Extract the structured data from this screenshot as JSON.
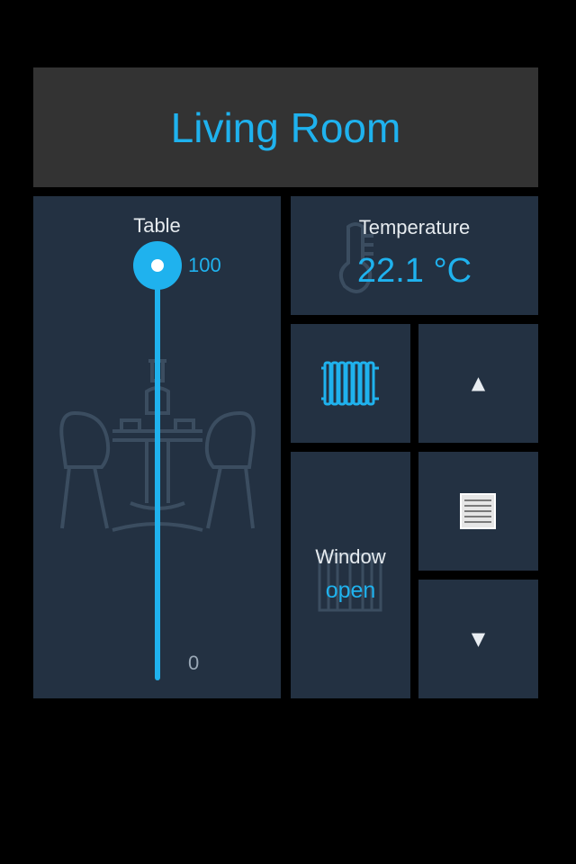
{
  "header": {
    "title": "Living Room"
  },
  "table_slider": {
    "label": "Table",
    "max_label": "100",
    "min_label": "0",
    "level": 100
  },
  "temperature": {
    "label": "Temperature",
    "value": "22.1 °C"
  },
  "heater": {
    "icon": "radiator-icon"
  },
  "window": {
    "label": "Window",
    "state": "open"
  },
  "shutter": {
    "up_glyph": "▲",
    "down_glyph": "▼",
    "stop_icon": "shutter-icon"
  },
  "colors": {
    "accent": "#1fb2ee",
    "tile": "#233142",
    "header": "#333333",
    "background": "#000000"
  }
}
